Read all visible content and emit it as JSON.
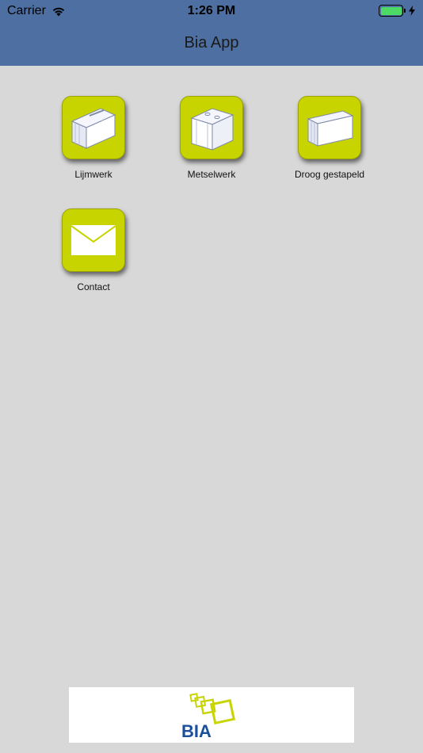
{
  "status_bar": {
    "carrier": "Carrier",
    "time": "1:26 PM",
    "battery_level": 1.0
  },
  "nav": {
    "title": "Bia App"
  },
  "tiles": [
    {
      "label": "Lijmwerk",
      "icon": "glued-block-icon"
    },
    {
      "label": "Metselwerk",
      "icon": "masonry-block-icon"
    },
    {
      "label": "Droog gestapeld",
      "icon": "dry-stacked-block-icon"
    },
    {
      "label": "Contact",
      "icon": "envelope-icon"
    }
  ],
  "banner": {
    "logo": "BIA"
  },
  "colors": {
    "header": "#4e6fa2",
    "background": "#d8d8d8",
    "tile": "#c8d400",
    "logo_blue": "#1a4f9c"
  }
}
